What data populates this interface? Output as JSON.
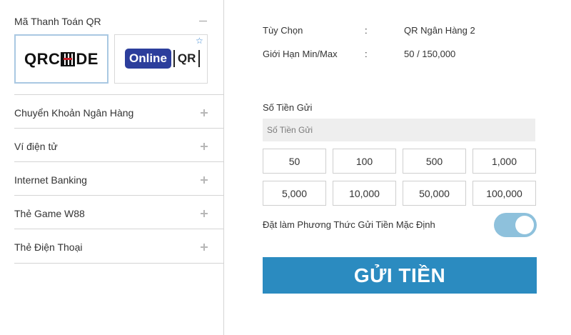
{
  "sidebar": {
    "section_title": "Mã Thanh Toán QR",
    "qr_options": [
      {
        "logo_text_left": "QRC",
        "logo_text_right": "DE"
      },
      {
        "logo_pill": "Online",
        "logo_qr": "QR"
      }
    ],
    "items": [
      {
        "label": "Chuyển Khoản Ngân Hàng"
      },
      {
        "label": "Ví điện tử"
      },
      {
        "label": "Internet Banking"
      },
      {
        "label": "Thẻ Game W88"
      },
      {
        "label": "Thẻ Điện Thoại"
      }
    ]
  },
  "info": {
    "option_label": "Tùy Chọn",
    "option_value": "QR Ngân Hàng 2",
    "limit_label": "Giới Hạn Min/Max",
    "limit_value": "50 / 150,000",
    "separator": ":"
  },
  "deposit": {
    "amount_label": "Số Tiền Gửi",
    "amount_placeholder": "Số Tiền Gửi",
    "amount_value": "",
    "quick_amounts": [
      "50",
      "100",
      "500",
      "1,000",
      "5,000",
      "10,000",
      "50,000",
      "100,000"
    ],
    "default_label": "Đặt làm Phương Thức Gửi Tiền Mặc Định",
    "default_enabled": true,
    "submit_label": "GỬI TIỀN"
  },
  "colors": {
    "submit_bg": "#2b8bc0",
    "toggle_on": "#8ec1dc",
    "online_pill": "#2c3e9c",
    "star": "#3a86d1"
  }
}
